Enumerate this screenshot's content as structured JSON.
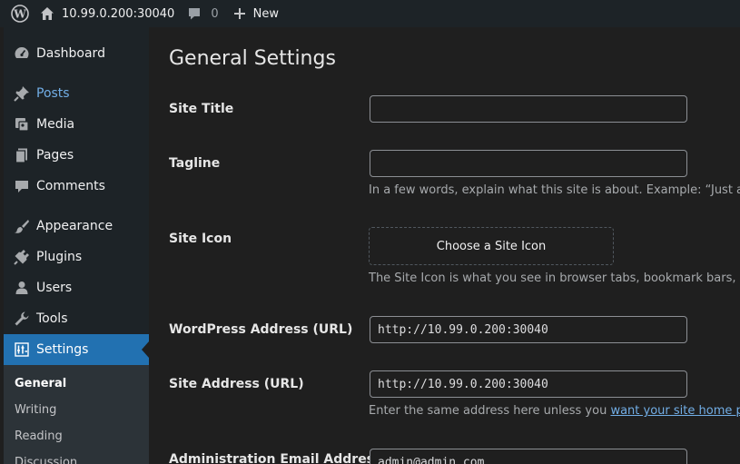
{
  "adminbar": {
    "site_name": "10.99.0.200:30040",
    "comments_count": "0",
    "new_label": "New"
  },
  "sidebar": {
    "items": [
      {
        "label": "Dashboard",
        "icon": "dashboard-icon"
      },
      {
        "label": "Posts",
        "icon": "pin-icon"
      },
      {
        "label": "Media",
        "icon": "media-icon"
      },
      {
        "label": "Pages",
        "icon": "pages-icon"
      },
      {
        "label": "Comments",
        "icon": "comment-icon"
      },
      {
        "label": "Appearance",
        "icon": "brush-icon"
      },
      {
        "label": "Plugins",
        "icon": "plug-icon"
      },
      {
        "label": "Users",
        "icon": "user-icon"
      },
      {
        "label": "Tools",
        "icon": "wrench-icon"
      },
      {
        "label": "Settings",
        "icon": "settings-icon"
      }
    ],
    "submenu": [
      "General",
      "Writing",
      "Reading",
      "Discussion"
    ]
  },
  "main": {
    "title": "General Settings",
    "site_title": {
      "label": "Site Title",
      "value": ""
    },
    "tagline": {
      "label": "Tagline",
      "value": "",
      "description": "In a few words, explain what this site is about. Example: “Just anot"
    },
    "site_icon": {
      "label": "Site Icon",
      "button": "Choose a Site Icon",
      "description": "The Site Icon is what you see in browser tabs, bookmark bars, and w"
    },
    "wp_address": {
      "label": "WordPress Address (URL)",
      "value": "http://10.99.0.200:30040"
    },
    "site_address": {
      "label": "Site Address (URL)",
      "value": "http://10.99.0.200:30040",
      "description_prefix": "Enter the same address here unless you ",
      "description_link": "want your site home page"
    },
    "admin_email": {
      "label": "Administration Email Address",
      "value": "admin@admin.com"
    }
  },
  "colors": {
    "accent": "#2271b1",
    "link": "#72aee6",
    "sidebar_bg": "#1d2327",
    "page_bg": "#1f1f1f"
  }
}
